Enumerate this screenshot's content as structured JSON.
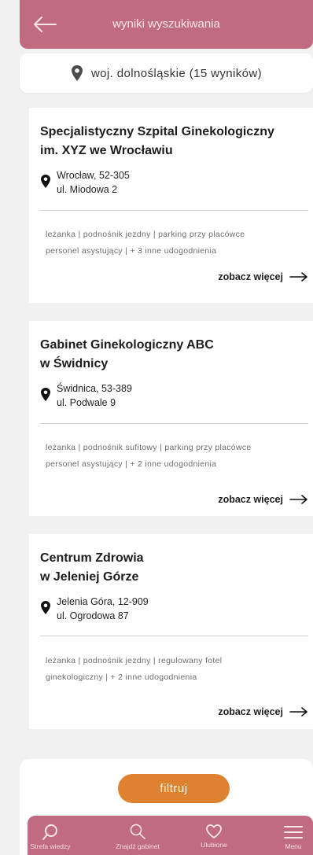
{
  "header": {
    "title": "wyniki wyszukiwania",
    "back_icon": "arrow-left-icon"
  },
  "region": {
    "label": "woj. dolnośląskie (15 wyników)",
    "icon": "map-pin-icon"
  },
  "results": [
    {
      "title_line1": "Specjalistyczny Szpital Ginekologiczny",
      "title_line2": "im. XYZ we Wrocławiu",
      "city": "Wrocław, 52-305",
      "street": "ul. Miodowa 2",
      "amenities_line1": "leżanka | podnośnik jezdny | parking przy placówce",
      "amenities_line2": "personel asystujący | + 3 inne udogodnienia",
      "more_label": "zobacz więcej"
    },
    {
      "title_line1": "Gabinet Ginekologiczny ABC",
      "title_line2": "w Świdnicy",
      "city": "Świdnica, 53-389",
      "street": "ul. Podwale 9",
      "amenities_line1": "leżanka | podnośnik sufitowy | parking przy placówce",
      "amenities_line2": "personel asystujący | + 2 inne udogodnienia",
      "more_label": "zobacz więcej"
    },
    {
      "title_line1": "Centrum Zdrowia",
      "title_line2": "w Jeleniej Górze",
      "city": "Jelenia Góra, 12-909",
      "street": "ul. Ogrodowa 87",
      "amenities_line1": "leżanka | podnośnik jezdny | regulowany fotel",
      "amenities_line2": "ginekologiczny | + 2 inne udogodnienia",
      "more_label": "zobacz więcej"
    }
  ],
  "filter": {
    "label": "filtruj"
  },
  "nav": {
    "items": [
      {
        "label": "Strefa wiedzy",
        "icon": "knowledge-search-icon"
      },
      {
        "label": "Znajdź gabinet",
        "icon": "search-icon"
      },
      {
        "label": "Ulubione",
        "icon": "heart-icon"
      },
      {
        "label": "Menu",
        "icon": "hamburger-menu-icon"
      }
    ]
  },
  "colors": {
    "primary": "#c06b82",
    "accent": "#df8230",
    "background": "#f1f1f1"
  }
}
